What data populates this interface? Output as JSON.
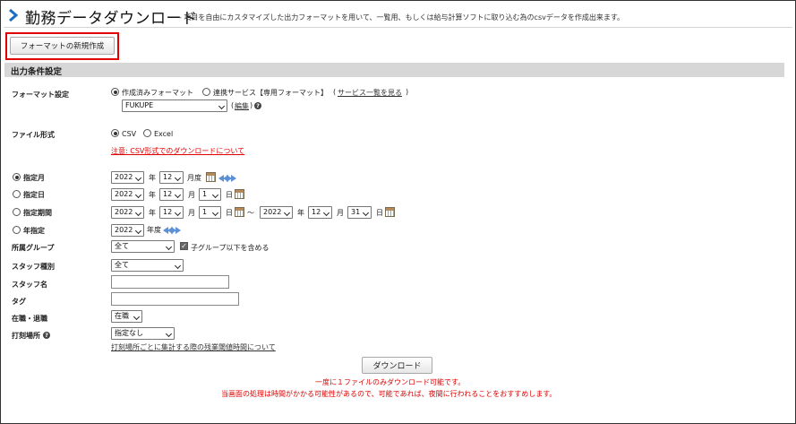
{
  "header": {
    "title": "勤務データダウンロード",
    "subtitle": "- 項目を自由にカスタマイズした出力フォーマットを用いて、一覧用、もしくは給与計算ソフトに取り込む為のcsvデータを作成出来ます。"
  },
  "new_format_button": "フォーマットの新規作成",
  "section_title": "出力条件設定",
  "format_setting": {
    "label": "フォーマット設定",
    "option_created": "作成済みフォーマット",
    "option_service": "連携サービス【専用フォーマット】",
    "service_link": "サービス一覧を見る",
    "paren_open": "(",
    "paren_close": ")",
    "selected_format": "FUKUPE",
    "edit_link": "編集"
  },
  "file_type": {
    "label": "ファイル形式",
    "csv": "CSV",
    "excel": "Excel",
    "csv_note": "注意: CSV形式でのダウンロードについて"
  },
  "period": {
    "month": {
      "label": "指定月",
      "year": "2022",
      "month": "12",
      "year_unit": "年",
      "month_unit": "月度"
    },
    "day": {
      "label": "指定日",
      "year": "2022",
      "month": "12",
      "day": "1",
      "year_unit": "年",
      "month_unit": "月",
      "day_unit": "日"
    },
    "range": {
      "label": "指定期間",
      "from": {
        "year": "2022",
        "month": "12",
        "day": "1"
      },
      "to": {
        "year": "2022",
        "month": "12",
        "day": "31"
      },
      "tilde": "〜",
      "year_unit": "年",
      "month_unit": "月",
      "day_unit": "日"
    },
    "year": {
      "label": "年指定",
      "year": "2022",
      "year_unit": "年度"
    }
  },
  "group": {
    "label": "所属グループ",
    "value": "全て",
    "include_sub": "子グループ以下を含める"
  },
  "staff_type": {
    "label": "スタッフ種別",
    "value": "全て"
  },
  "staff_name": {
    "label": "スタッフ名"
  },
  "tag": {
    "label": "タグ"
  },
  "employment": {
    "label": "在職・退職",
    "value": "在職"
  },
  "punch_place": {
    "label": "打刻場所",
    "value": "指定なし",
    "link": "打刻場所ごとに集計する際の残業閾値時間について"
  },
  "download_button": "ダウンロード",
  "notice1": "一度に１ファイルのみダウンロード可能です。",
  "notice2": "当画面の処理は時間がかかる可能性があるので、可能であれば、夜間に行われることをおすすめします。",
  "colors": {
    "accent": "#1a6fc4",
    "highlight": "#e00000",
    "section_bg": "#d7d7d7"
  }
}
